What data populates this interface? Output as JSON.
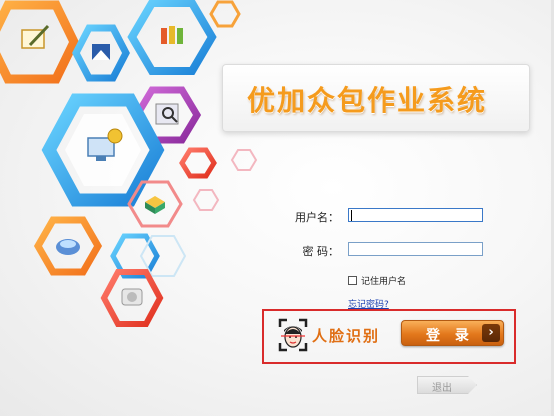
{
  "app": {
    "title": "优加众包作业系统"
  },
  "login_form": {
    "username_label": "用户名：",
    "username_value": "",
    "password_label": "密  码：",
    "password_value": "",
    "remember_label": "记住用户名",
    "remember_checked": false,
    "forgot_link": "忘记密码?",
    "face_login_label": "人脸识别",
    "login_button": "登  录",
    "login_arrow": "›",
    "exit_button": "退出"
  },
  "colors": {
    "title_orange": "#f59b1d",
    "login_orange": "#e3781c",
    "highlight_red": "#d92b2b",
    "link_blue": "#1a3fb0"
  },
  "icons": [
    "edit-icon",
    "chart-icon",
    "folder-icon",
    "computer-icon",
    "magnifier-icon",
    "database-icon",
    "drive-icon",
    "disc-icon",
    "face-scan-icon"
  ]
}
